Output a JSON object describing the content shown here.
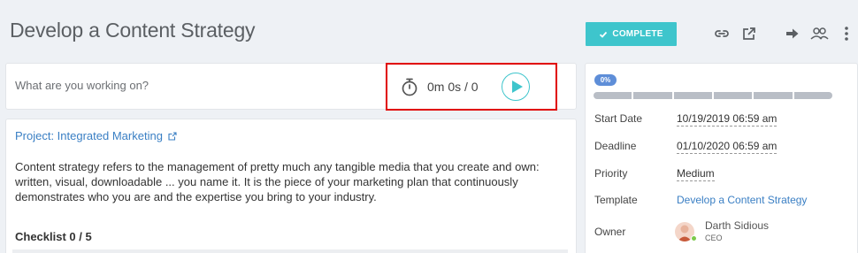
{
  "header": {
    "title": "Develop a Content Strategy",
    "complete_label": "COMPLETE"
  },
  "tracker": {
    "placeholder": "What are you working on?",
    "time": "0m 0s / 0"
  },
  "main": {
    "project_link": "Project: Integrated Marketing",
    "description": "Content strategy refers to the management of pretty much any tangible media that you create and own: written, visual, downloadable ... you name it. It is the piece of your marketing plan that continuously demonstrates who you are and the expertise you bring to your industry.",
    "checklist_label": "Checklist 0 / 5"
  },
  "sidebar": {
    "progress_label": "0%",
    "progress": 0,
    "start_date_label": "Start Date",
    "start_date": "10/19/2019 06:59 am",
    "deadline_label": "Deadline",
    "deadline": "01/10/2020 06:59 am",
    "priority_label": "Priority",
    "priority": "Medium",
    "template_label": "Template",
    "template": "Develop a Content Strategy",
    "owner_label": "Owner",
    "owner_name": "Darth Sidious",
    "owner_role": "CEO"
  },
  "colors": {
    "accent": "#3ec5cc",
    "link": "#3a7fc4",
    "highlight": "#e00000",
    "badge": "#5e8ed8",
    "online": "#7cc94a"
  },
  "icons": [
    "link-icon",
    "external-link-icon",
    "arrow-right-icon",
    "users-icon",
    "more-vertical-icon",
    "stopwatch-icon",
    "play-icon",
    "check-icon"
  ]
}
